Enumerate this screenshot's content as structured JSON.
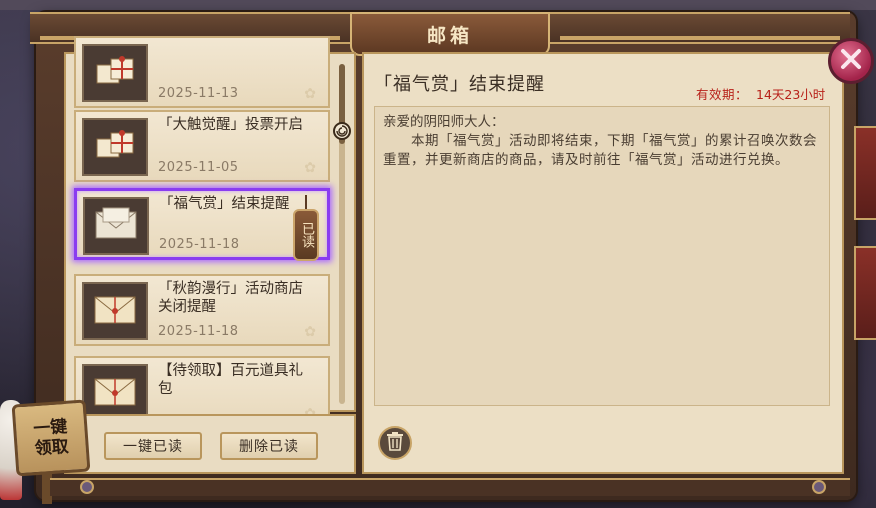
{
  "header": {
    "title": "邮箱"
  },
  "mail_list": [
    {
      "title": "",
      "date": "2025-11-13",
      "selected": false,
      "read_tag": "",
      "thumb_icon": "gift-package-icon"
    },
    {
      "title": "「大触觉醒」投票开启",
      "date": "2025-11-05",
      "selected": false,
      "read_tag": "",
      "thumb_icon": "gift-package-icon"
    },
    {
      "title": "「福气赏」结束提醒",
      "date": "2025-11-18",
      "selected": true,
      "read_tag": "已读",
      "thumb_icon": "letter-open-icon"
    },
    {
      "title": "「秋韵漫行」活动商店关闭提醒",
      "date": "2025-11-18",
      "selected": false,
      "read_tag": "",
      "thumb_icon": "letter-sealed-icon"
    },
    {
      "title": "【待领取】百元道具礼包",
      "date": "",
      "selected": false,
      "read_tag": "",
      "thumb_icon": "letter-sealed-icon"
    }
  ],
  "actions": {
    "claim_all": "一键领取",
    "read_all": "一键已读",
    "delete_read": "删除已读"
  },
  "detail": {
    "title": "「福气赏」结束提醒",
    "expiry_label": "有效期：",
    "expiry_value": "14天23小时",
    "greeting": "亲爱的阴阳师大人：",
    "body": "本期「福气赏」活动即将结束，下期「福气赏」的累计召唤次数会重置，并更新商店的商品，请及时前往「福气赏」活动进行兑换。"
  },
  "colors": {
    "accent_select": "#8a3cf0",
    "expiry_red": "#b8221a",
    "frame_gold": "#c8a467"
  }
}
